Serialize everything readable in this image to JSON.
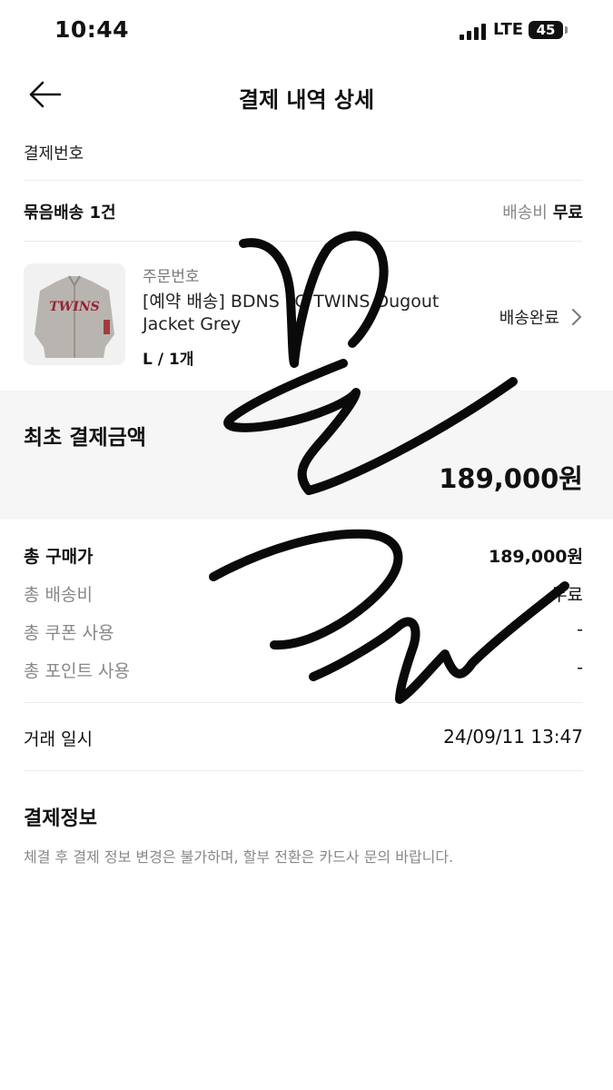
{
  "status_bar": {
    "time": "10:44",
    "network": "LTE",
    "battery": "45"
  },
  "header": {
    "title": "결제 내역 상세"
  },
  "order_number_label": "결제번호",
  "bundle": {
    "label": "묶음배송 1건",
    "shipping_fee_label": "배송비",
    "shipping_fee_value": "무료"
  },
  "product": {
    "order_no_label": "주문번호",
    "thumbnail_text": "TWINS",
    "name": "[예약 배송] BDNS LG TWINS Dugout Jacket Grey",
    "option": "L / 1개",
    "status": "배송완료"
  },
  "initial_payment": {
    "label": "최초 결제금액",
    "amount": "189,000원"
  },
  "summary": [
    {
      "label": "총 구매가",
      "value": "189,000원"
    },
    {
      "label": "총 배송비",
      "value": "무료"
    },
    {
      "label": "총 쿠폰 사용",
      "value": "-"
    },
    {
      "label": "총 포인트 사용",
      "value": "-"
    }
  ],
  "transaction": {
    "label": "거래 일시",
    "value": "24/09/11 13:47"
  },
  "payment_info": {
    "title": "결제정보",
    "notice": "체결 후 결제 정보 변경은 불가하며, 할부 전환은 카드사 문의 바랍니다."
  },
  "colors": {
    "muted": "#888888",
    "divider": "#ececec",
    "highlight_bg": "#f6f6f6"
  }
}
